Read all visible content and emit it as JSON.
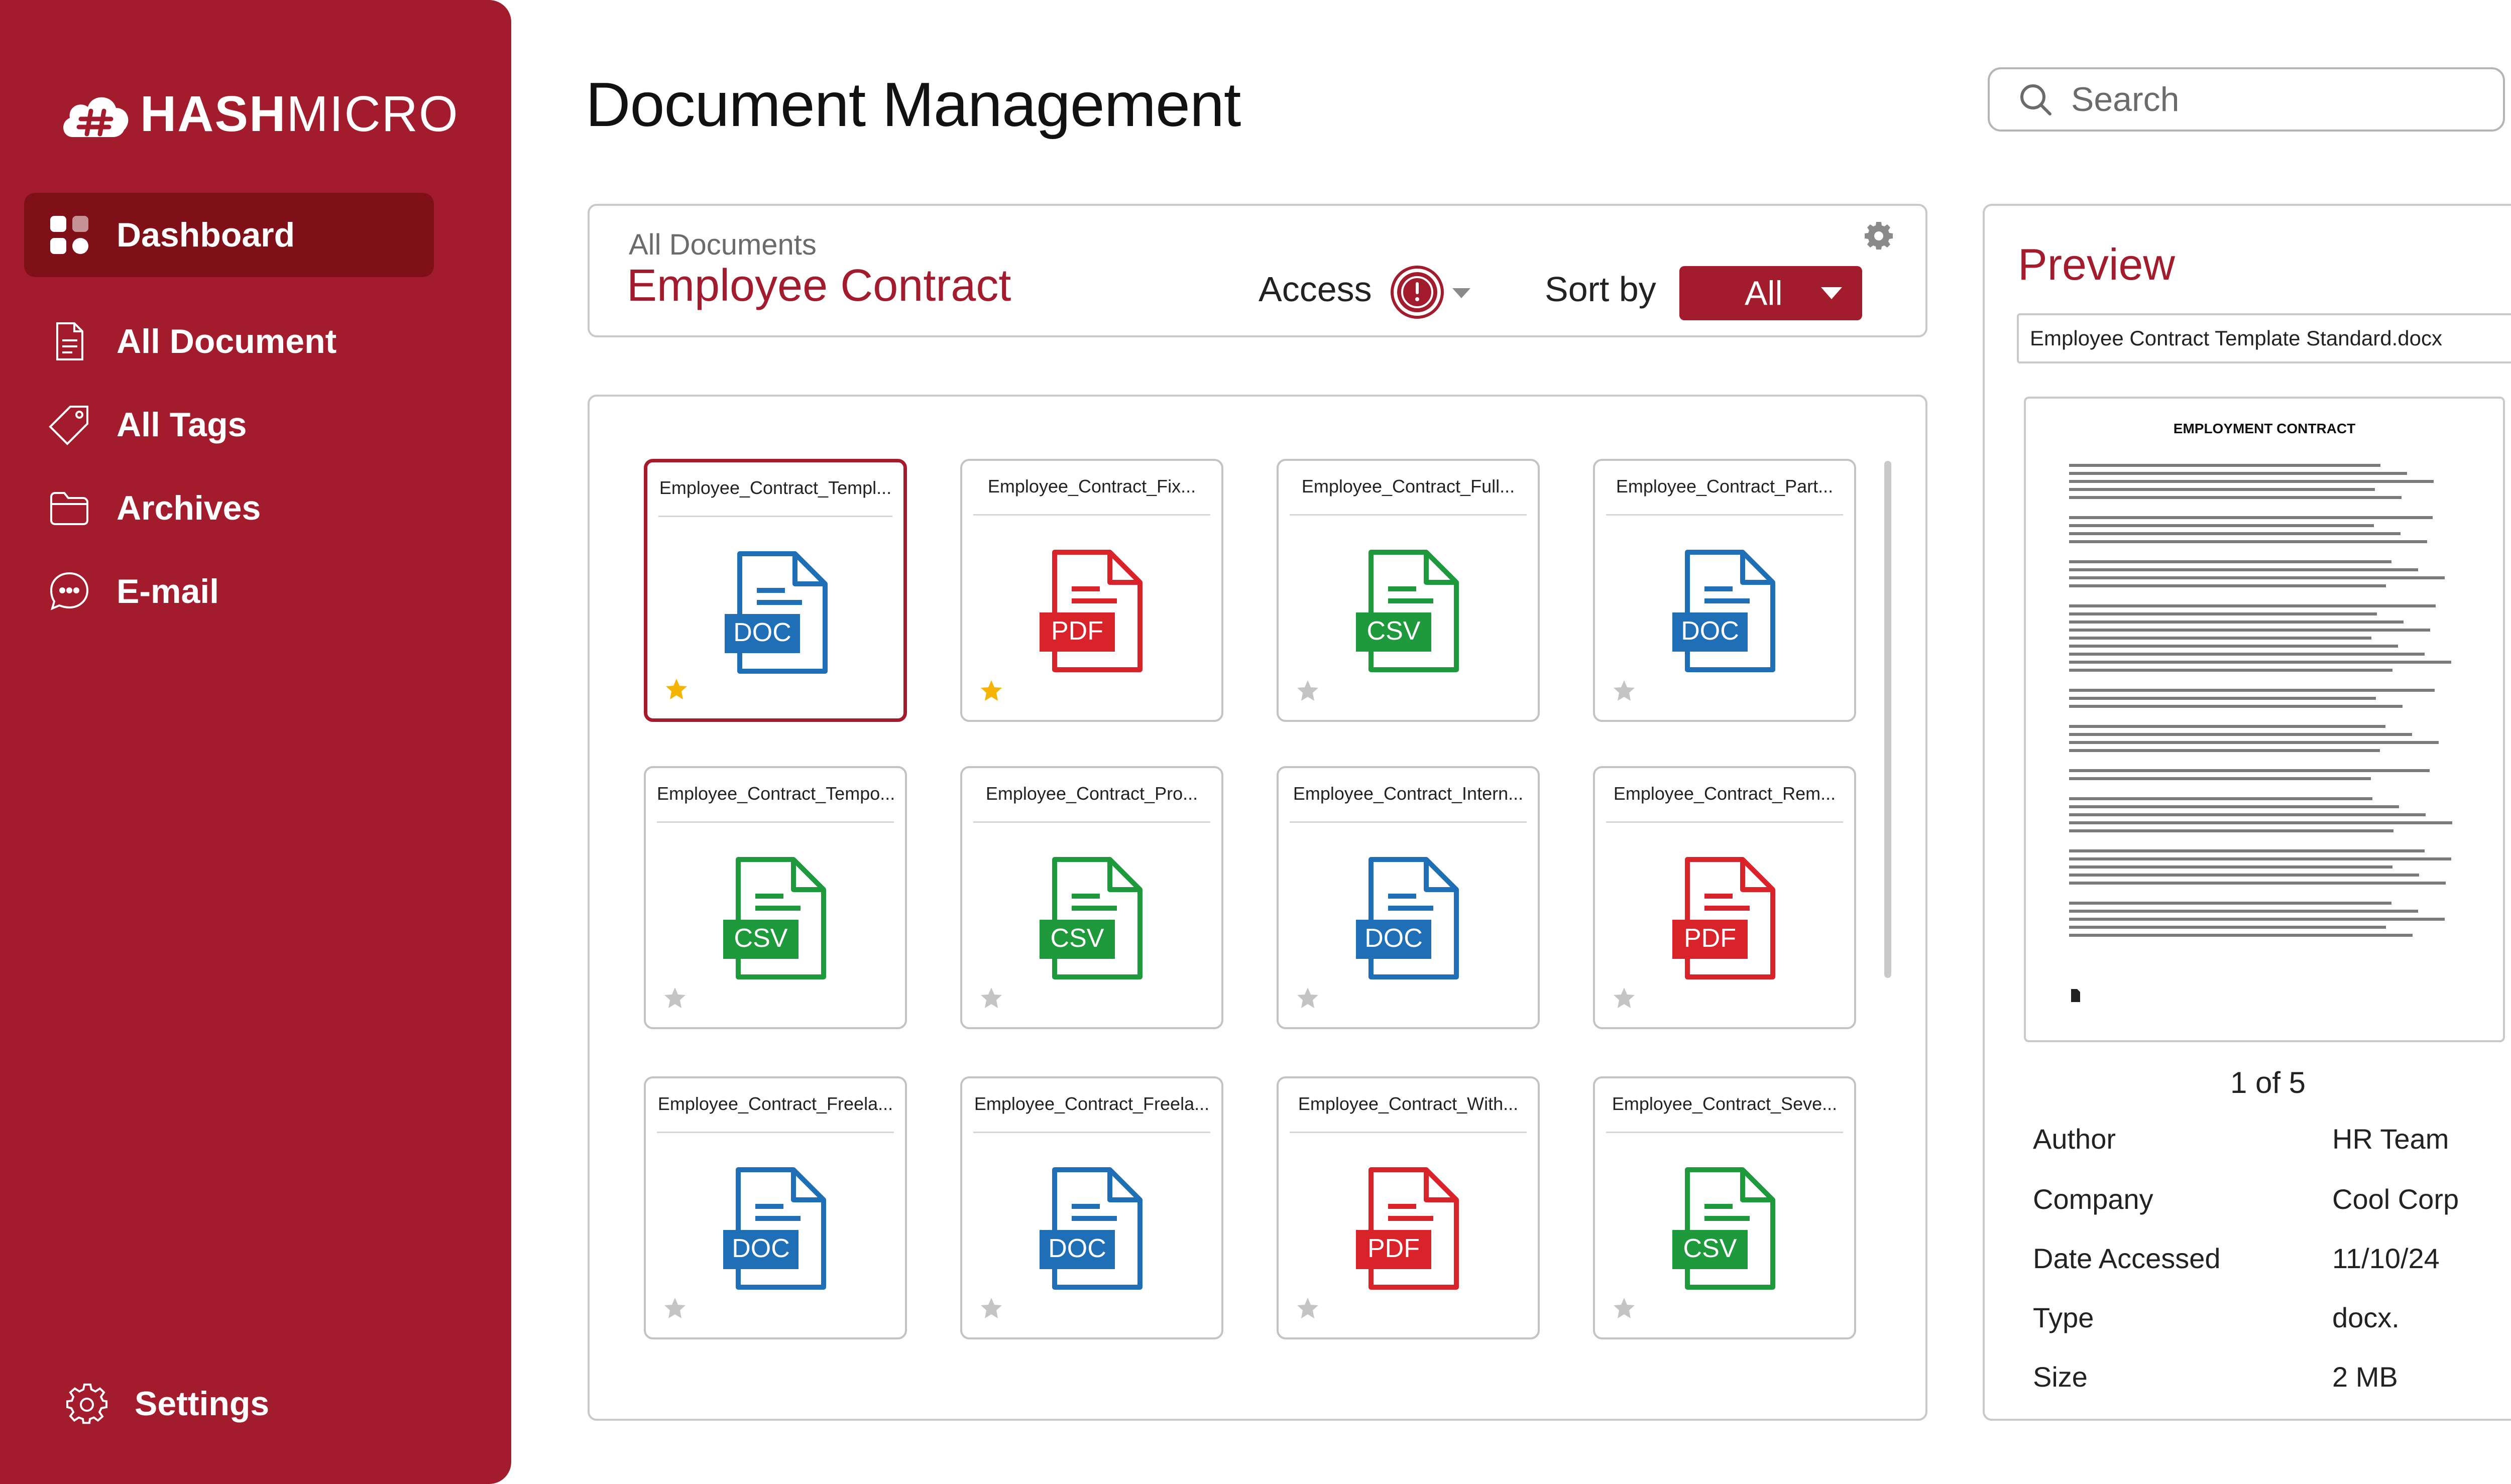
{
  "brand": {
    "name_bold": "HASH",
    "name_light": "MICRO"
  },
  "sidebar": {
    "items": [
      {
        "label": "Dashboard",
        "icon": "grid-icon",
        "active": true
      },
      {
        "label": "All Document",
        "icon": "document-icon"
      },
      {
        "label": "All Tags",
        "icon": "tag-icon"
      },
      {
        "label": "Archives",
        "icon": "folder-icon"
      },
      {
        "label": "E-mail",
        "icon": "chat-icon"
      }
    ],
    "settings_label": "Settings"
  },
  "header": {
    "title": "Document Management",
    "search_placeholder": "Search"
  },
  "filter": {
    "breadcrumb": "All Documents",
    "folder": "Employee Contract",
    "access_label": "Access",
    "sort_label": "Sort by",
    "sort_value": "All"
  },
  "files": [
    {
      "name": "Employee_Contract_Templ...",
      "type": "DOC",
      "starred": true,
      "selected": true
    },
    {
      "name": "Employee_Contract_Fix...",
      "type": "PDF",
      "starred": true
    },
    {
      "name": "Employee_Contract_Full...",
      "type": "CSV",
      "starred": false
    },
    {
      "name": "Employee_Contract_Part...",
      "type": "DOC",
      "starred": false
    },
    {
      "name": "Employee_Contract_Tempo...",
      "type": "CSV",
      "starred": false
    },
    {
      "name": "Employee_Contract_Pro...",
      "type": "CSV",
      "starred": false
    },
    {
      "name": "Employee_Contract_Intern...",
      "type": "DOC",
      "starred": false
    },
    {
      "name": "Employee_Contract_Rem...",
      "type": "PDF",
      "starred": false
    },
    {
      "name": "Employee_Contract_Freela...",
      "type": "DOC",
      "starred": false
    },
    {
      "name": "Employee_Contract_Freela...",
      "type": "DOC",
      "starred": false
    },
    {
      "name": "Employee_Contract_With...",
      "type": "PDF",
      "starred": false
    },
    {
      "name": "Employee_Contract_Seve...",
      "type": "CSV",
      "starred": false
    }
  ],
  "file_colors": {
    "DOC": "#1f6fb7",
    "PDF": "#d8232a",
    "CSV": "#1e9a3c"
  },
  "preview": {
    "title": "Preview",
    "filename": "Employee Contract Template Standard.docx",
    "doc_heading": "EMPLOYMENT CONTRACT",
    "page_indicator": "1 of 5",
    "meta": [
      {
        "key": "Author",
        "value": "HR Team"
      },
      {
        "key": "Company",
        "value": "Cool Corp"
      },
      {
        "key": "Date Accessed",
        "value": "11/10/24"
      },
      {
        "key": "Type",
        "value": "docx."
      },
      {
        "key": "Size",
        "value": "2 MB"
      }
    ]
  },
  "colors": {
    "brand": "#a31c2d",
    "brand_dark": "#7f1018",
    "star_active": "#f5b400",
    "star_inactive": "#c4c4c4"
  }
}
